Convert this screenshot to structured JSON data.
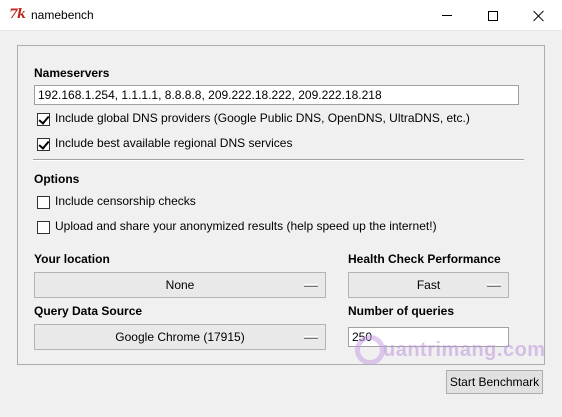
{
  "window": {
    "title": "namebench",
    "icon_text": "7k"
  },
  "nameservers": {
    "heading": "Nameservers",
    "value": "192.168.1.254, 1.1.1.1, 8.8.8.8, 209.222.18.222, 209.222.18.218",
    "include_global": {
      "label": "Include global DNS providers (Google Public DNS, OpenDNS, UltraDNS, etc.)",
      "checked": true
    },
    "include_regional": {
      "label": "Include best available regional DNS services",
      "checked": true
    }
  },
  "options": {
    "heading": "Options",
    "censorship": {
      "label": "Include censorship checks",
      "checked": false
    },
    "upload": {
      "label": "Upload and share your anonymized results (help speed up the internet!)",
      "checked": false
    }
  },
  "location": {
    "label": "Your location",
    "selected": "None"
  },
  "health_check": {
    "label": "Health Check Performance",
    "selected": "Fast"
  },
  "query_source": {
    "label": "Query Data Source",
    "selected": "Google Chrome (17915)"
  },
  "num_queries": {
    "label": "Number of queries",
    "value": "250"
  },
  "start_button": "Start Benchmark",
  "watermark": "uantrimang.com"
}
